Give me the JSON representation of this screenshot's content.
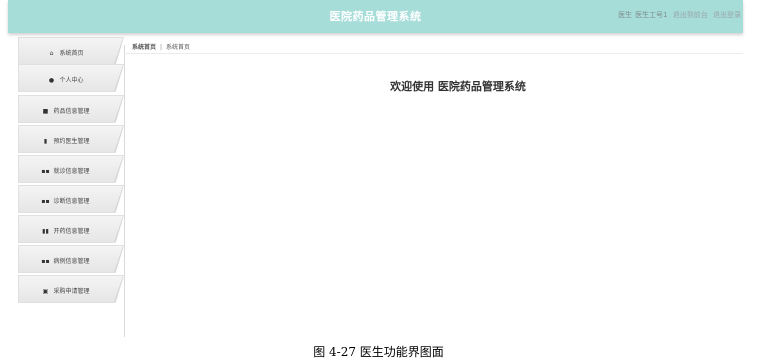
{
  "header": {
    "app_title": "医院药品管理系统",
    "user_role": "医生",
    "user_name": "医生工号1",
    "back_link": "退出到前台",
    "logout_link": "退出登录"
  },
  "sidebar": {
    "items": [
      {
        "label": "系统首页",
        "icon": "home-icon",
        "glyph": "⌂"
      },
      {
        "label": "个人中心",
        "icon": "user-icon",
        "glyph": "●"
      },
      {
        "label": "药品信息管理",
        "icon": "briefcase-icon",
        "glyph": "■"
      },
      {
        "label": "预约医生管理",
        "icon": "document-icon",
        "glyph": "▮"
      },
      {
        "label": "就诊信息管理",
        "icon": "grid-icon",
        "glyph": "▪▪"
      },
      {
        "label": "诊断信息管理",
        "icon": "grid-icon",
        "glyph": "▪▪"
      },
      {
        "label": "开药信息管理",
        "icon": "chart-icon",
        "glyph": "▮▮"
      },
      {
        "label": "病例信息管理",
        "icon": "grid-icon",
        "glyph": "▪▪"
      },
      {
        "label": "采购申请管理",
        "icon": "clipboard-icon",
        "glyph": "▣"
      }
    ]
  },
  "breadcrumb": {
    "first": "系统首页",
    "separator": "|",
    "current": "系统首页"
  },
  "main": {
    "welcome": "欢迎使用 医院药品管理系统"
  },
  "caption": "图 4-27 医生功能界图面"
}
